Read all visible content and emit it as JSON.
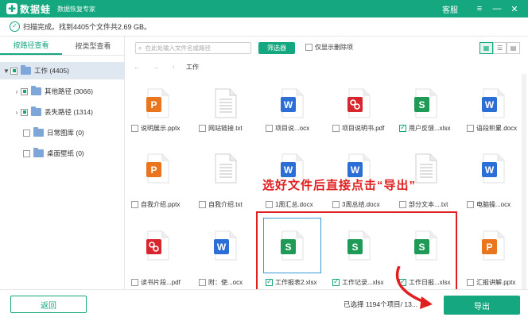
{
  "app": {
    "name": "数据蛙",
    "subtitle": "数据恢复专家",
    "service": "客服"
  },
  "window_buttons": {
    "menu": "≡",
    "minimize": "—",
    "close": "✕"
  },
  "status": {
    "text": "扫描完成。找到4405个文件共2.69 GB。"
  },
  "left_tabs": {
    "by_path": "按路径查看",
    "by_type": "按类型查看"
  },
  "tree": {
    "root": {
      "label": "工作 (4405)"
    },
    "other": {
      "label": "其他路径 (3066)"
    },
    "lost": {
      "label": "丢失路径 (1314)"
    },
    "gallery": {
      "label": "日常图库 (0)"
    },
    "wallpaper": {
      "label": "桌面壁纸 (0)"
    }
  },
  "search": {
    "placeholder": "在此处输入文件名或路径"
  },
  "filter_label": "筛选器",
  "show_deleted_label": "仅显示删除项",
  "path": {
    "current": "工作"
  },
  "nav": {
    "back": "←",
    "forward": "→",
    "up": "↑"
  },
  "files": [
    {
      "name": "说明展示.pptx",
      "type": "pptx",
      "checked": false
    },
    {
      "name": "网站链接.txt",
      "type": "txt",
      "checked": false
    },
    {
      "name": "项目说...ocx",
      "type": "docx",
      "checked": false
    },
    {
      "name": "项目说明书.pdf",
      "type": "pdf",
      "checked": false
    },
    {
      "name": "用户反馈...xlsx",
      "type": "xlsx",
      "checked": true
    },
    {
      "name": "语段积累.docx",
      "type": "docx",
      "checked": false
    },
    {
      "name": "自我介绍.pptx",
      "type": "pptx",
      "checked": false
    },
    {
      "name": "自我介绍.txt",
      "type": "txt",
      "checked": false
    },
    {
      "name": "1周汇总.docx",
      "type": "docx",
      "checked": false
    },
    {
      "name": "3周总结.docx",
      "type": "docx",
      "checked": false
    },
    {
      "name": "部分文本....txt",
      "type": "txt",
      "checked": false
    },
    {
      "name": "电脑操...ocx",
      "type": "docx",
      "checked": false
    },
    {
      "name": "读书片段...pdf",
      "type": "pdf",
      "checked": false
    },
    {
      "name": "附：使...ocx",
      "type": "docx",
      "checked": false
    },
    {
      "name": "工作报表2.xlsx",
      "type": "xlsx",
      "checked": true
    },
    {
      "name": "工作记录...xlsx",
      "type": "xlsx",
      "checked": true
    },
    {
      "name": "工作日报...xlsx",
      "type": "xlsx",
      "checked": true
    },
    {
      "name": "汇报讲解.pptx",
      "type": "pptx",
      "checked": false
    }
  ],
  "annotation": "选好文件后直接点击“导出”",
  "bottom": {
    "back": "返回",
    "selected": "已选择 1194个项目/ 13...",
    "export": "导出"
  },
  "colors": {
    "accent": "#15a77f",
    "pptx": "#e9761e",
    "docx": "#2b6fd6",
    "pdf": "#d8262f",
    "xlsx": "#1f9a57",
    "annotation": "#e02020"
  },
  "icons": {
    "pptx": "P",
    "docx": "W",
    "xlsx": "S",
    "pdf": "pdf-icon",
    "txt": "txt-icon"
  }
}
